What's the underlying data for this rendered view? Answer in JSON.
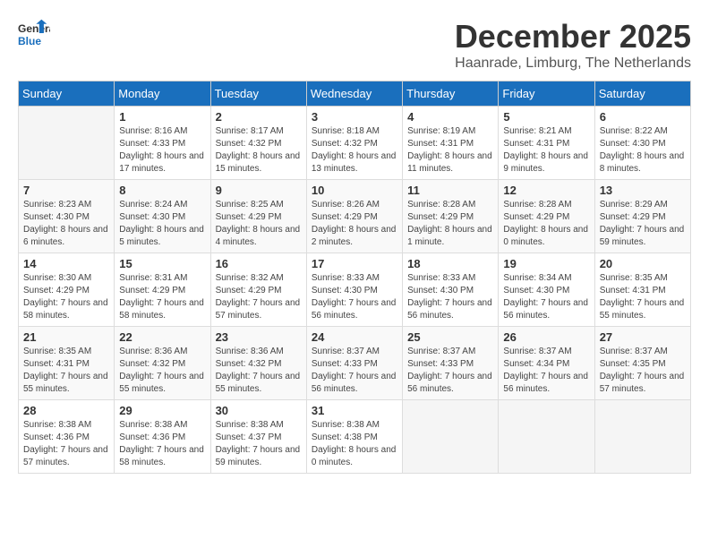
{
  "logo": {
    "line1": "General",
    "line2": "Blue"
  },
  "title": "December 2025",
  "location": "Haanrade, Limburg, The Netherlands",
  "days_of_week": [
    "Sunday",
    "Monday",
    "Tuesday",
    "Wednesday",
    "Thursday",
    "Friday",
    "Saturday"
  ],
  "weeks": [
    [
      {
        "day": "",
        "sunrise": "",
        "sunset": "",
        "daylight": ""
      },
      {
        "day": "1",
        "sunrise": "Sunrise: 8:16 AM",
        "sunset": "Sunset: 4:33 PM",
        "daylight": "Daylight: 8 hours and 17 minutes."
      },
      {
        "day": "2",
        "sunrise": "Sunrise: 8:17 AM",
        "sunset": "Sunset: 4:32 PM",
        "daylight": "Daylight: 8 hours and 15 minutes."
      },
      {
        "day": "3",
        "sunrise": "Sunrise: 8:18 AM",
        "sunset": "Sunset: 4:32 PM",
        "daylight": "Daylight: 8 hours and 13 minutes."
      },
      {
        "day": "4",
        "sunrise": "Sunrise: 8:19 AM",
        "sunset": "Sunset: 4:31 PM",
        "daylight": "Daylight: 8 hours and 11 minutes."
      },
      {
        "day": "5",
        "sunrise": "Sunrise: 8:21 AM",
        "sunset": "Sunset: 4:31 PM",
        "daylight": "Daylight: 8 hours and 9 minutes."
      },
      {
        "day": "6",
        "sunrise": "Sunrise: 8:22 AM",
        "sunset": "Sunset: 4:30 PM",
        "daylight": "Daylight: 8 hours and 8 minutes."
      }
    ],
    [
      {
        "day": "7",
        "sunrise": "Sunrise: 8:23 AM",
        "sunset": "Sunset: 4:30 PM",
        "daylight": "Daylight: 8 hours and 6 minutes."
      },
      {
        "day": "8",
        "sunrise": "Sunrise: 8:24 AM",
        "sunset": "Sunset: 4:30 PM",
        "daylight": "Daylight: 8 hours and 5 minutes."
      },
      {
        "day": "9",
        "sunrise": "Sunrise: 8:25 AM",
        "sunset": "Sunset: 4:29 PM",
        "daylight": "Daylight: 8 hours and 4 minutes."
      },
      {
        "day": "10",
        "sunrise": "Sunrise: 8:26 AM",
        "sunset": "Sunset: 4:29 PM",
        "daylight": "Daylight: 8 hours and 2 minutes."
      },
      {
        "day": "11",
        "sunrise": "Sunrise: 8:28 AM",
        "sunset": "Sunset: 4:29 PM",
        "daylight": "Daylight: 8 hours and 1 minute."
      },
      {
        "day": "12",
        "sunrise": "Sunrise: 8:28 AM",
        "sunset": "Sunset: 4:29 PM",
        "daylight": "Daylight: 8 hours and 0 minutes."
      },
      {
        "day": "13",
        "sunrise": "Sunrise: 8:29 AM",
        "sunset": "Sunset: 4:29 PM",
        "daylight": "Daylight: 7 hours and 59 minutes."
      }
    ],
    [
      {
        "day": "14",
        "sunrise": "Sunrise: 8:30 AM",
        "sunset": "Sunset: 4:29 PM",
        "daylight": "Daylight: 7 hours and 58 minutes."
      },
      {
        "day": "15",
        "sunrise": "Sunrise: 8:31 AM",
        "sunset": "Sunset: 4:29 PM",
        "daylight": "Daylight: 7 hours and 58 minutes."
      },
      {
        "day": "16",
        "sunrise": "Sunrise: 8:32 AM",
        "sunset": "Sunset: 4:29 PM",
        "daylight": "Daylight: 7 hours and 57 minutes."
      },
      {
        "day": "17",
        "sunrise": "Sunrise: 8:33 AM",
        "sunset": "Sunset: 4:30 PM",
        "daylight": "Daylight: 7 hours and 56 minutes."
      },
      {
        "day": "18",
        "sunrise": "Sunrise: 8:33 AM",
        "sunset": "Sunset: 4:30 PM",
        "daylight": "Daylight: 7 hours and 56 minutes."
      },
      {
        "day": "19",
        "sunrise": "Sunrise: 8:34 AM",
        "sunset": "Sunset: 4:30 PM",
        "daylight": "Daylight: 7 hours and 56 minutes."
      },
      {
        "day": "20",
        "sunrise": "Sunrise: 8:35 AM",
        "sunset": "Sunset: 4:31 PM",
        "daylight": "Daylight: 7 hours and 55 minutes."
      }
    ],
    [
      {
        "day": "21",
        "sunrise": "Sunrise: 8:35 AM",
        "sunset": "Sunset: 4:31 PM",
        "daylight": "Daylight: 7 hours and 55 minutes."
      },
      {
        "day": "22",
        "sunrise": "Sunrise: 8:36 AM",
        "sunset": "Sunset: 4:32 PM",
        "daylight": "Daylight: 7 hours and 55 minutes."
      },
      {
        "day": "23",
        "sunrise": "Sunrise: 8:36 AM",
        "sunset": "Sunset: 4:32 PM",
        "daylight": "Daylight: 7 hours and 55 minutes."
      },
      {
        "day": "24",
        "sunrise": "Sunrise: 8:37 AM",
        "sunset": "Sunset: 4:33 PM",
        "daylight": "Daylight: 7 hours and 56 minutes."
      },
      {
        "day": "25",
        "sunrise": "Sunrise: 8:37 AM",
        "sunset": "Sunset: 4:33 PM",
        "daylight": "Daylight: 7 hours and 56 minutes."
      },
      {
        "day": "26",
        "sunrise": "Sunrise: 8:37 AM",
        "sunset": "Sunset: 4:34 PM",
        "daylight": "Daylight: 7 hours and 56 minutes."
      },
      {
        "day": "27",
        "sunrise": "Sunrise: 8:37 AM",
        "sunset": "Sunset: 4:35 PM",
        "daylight": "Daylight: 7 hours and 57 minutes."
      }
    ],
    [
      {
        "day": "28",
        "sunrise": "Sunrise: 8:38 AM",
        "sunset": "Sunset: 4:36 PM",
        "daylight": "Daylight: 7 hours and 57 minutes."
      },
      {
        "day": "29",
        "sunrise": "Sunrise: 8:38 AM",
        "sunset": "Sunset: 4:36 PM",
        "daylight": "Daylight: 7 hours and 58 minutes."
      },
      {
        "day": "30",
        "sunrise": "Sunrise: 8:38 AM",
        "sunset": "Sunset: 4:37 PM",
        "daylight": "Daylight: 7 hours and 59 minutes."
      },
      {
        "day": "31",
        "sunrise": "Sunrise: 8:38 AM",
        "sunset": "Sunset: 4:38 PM",
        "daylight": "Daylight: 8 hours and 0 minutes."
      },
      {
        "day": "",
        "sunrise": "",
        "sunset": "",
        "daylight": ""
      },
      {
        "day": "",
        "sunrise": "",
        "sunset": "",
        "daylight": ""
      },
      {
        "day": "",
        "sunrise": "",
        "sunset": "",
        "daylight": ""
      }
    ]
  ]
}
